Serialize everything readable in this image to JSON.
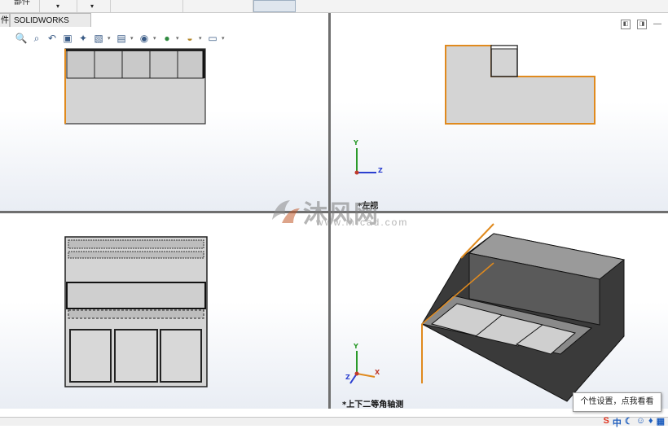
{
  "ribbon": {
    "tab_parts": "部件",
    "dropdown_a": "▾",
    "dropdown_b": "▾"
  },
  "tabs": {
    "partial_left": "件",
    "mbd": "SOLIDWORKS MBD"
  },
  "toolbar": {
    "icons": [
      "zoom-to-fit-icon",
      "zoom-area-icon",
      "previous-view-icon",
      "section-view-icon",
      "dynamic-annotation-icon",
      "view-orientation-icon",
      "display-style-icon",
      "hide-show-icon",
      "edit-appearance-icon",
      "apply-scene-icon",
      "view-settings-icon"
    ]
  },
  "viewports": {
    "top_right_label": "*左视",
    "bottom_right_label": "*上下二等角轴测"
  },
  "triad": {
    "y": "Y",
    "z": "Z",
    "x": "X"
  },
  "watermark": {
    "text": "沐风网",
    "url": "www.mfcad.com"
  },
  "tooltip": {
    "text": "个性设置，点我看看"
  },
  "tray": {
    "s": "S",
    "lang": "中",
    "moon": "☾",
    "smile": "☺",
    "mic": "♦",
    "grid": "▦"
  },
  "colors": {
    "edge_orange": "#e08a1e",
    "body_gray": "#d4d4d4",
    "dark_body": "#3a3a3a",
    "triad_green": "#2a9a2a",
    "triad_blue": "#2b3fd0",
    "triad_red": "#c0392b"
  }
}
